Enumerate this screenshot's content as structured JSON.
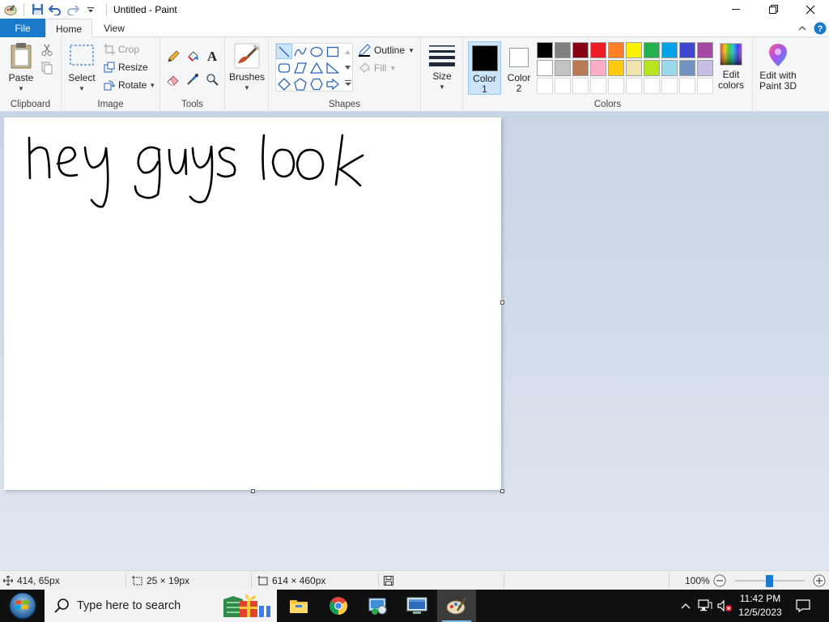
{
  "window": {
    "title": "Untitled - Paint",
    "minimize_icon": "minimize-icon",
    "maximize_icon": "restore-icon",
    "close_icon": "close-icon"
  },
  "tabs": {
    "file": "File",
    "home": "Home",
    "view": "View"
  },
  "ribbon": {
    "clipboard": {
      "label": "Clipboard",
      "paste": "Paste"
    },
    "image": {
      "label": "Image",
      "select": "Select",
      "crop": "Crop",
      "resize": "Resize",
      "rotate": "Rotate"
    },
    "tools": {
      "label": "Tools"
    },
    "brushes": {
      "label": "Brushes"
    },
    "shapes": {
      "label": "Shapes",
      "outline": "Outline",
      "fill": "Fill"
    },
    "size": {
      "label": "Size"
    },
    "colors": {
      "label": "Colors",
      "color1": {
        "label": "Color",
        "num": "1",
        "value": "#000000"
      },
      "color2": {
        "label": "Color",
        "num": "2",
        "value": "#ffffff"
      },
      "palette_row1": [
        "#000000",
        "#7f7f7f",
        "#880015",
        "#ed1c24",
        "#ff7f27",
        "#fff200",
        "#22b14c",
        "#00a2e8",
        "#3f48cc",
        "#a349a4"
      ],
      "palette_row2": [
        "#ffffff",
        "#c3c3c3",
        "#b97a57",
        "#ffaec9",
        "#ffc90e",
        "#efe4b0",
        "#b5e61d",
        "#99d9ea",
        "#7092be",
        "#c8bfe7"
      ],
      "edit_colors": [
        "Edit",
        "colors"
      ],
      "edit_paint3d": [
        "Edit with",
        "Paint 3D"
      ]
    }
  },
  "canvas": {
    "drawn_text": "hey guys look",
    "text_color": "#000000"
  },
  "status": {
    "cursor_pos": "414, 65px",
    "selection_size": "25 × 19px",
    "image_size": "614 × 460px",
    "zoom": "100%"
  },
  "taskbar": {
    "search_placeholder": "Type here to search",
    "time": "11:42 PM",
    "date": "12/5/2023"
  }
}
